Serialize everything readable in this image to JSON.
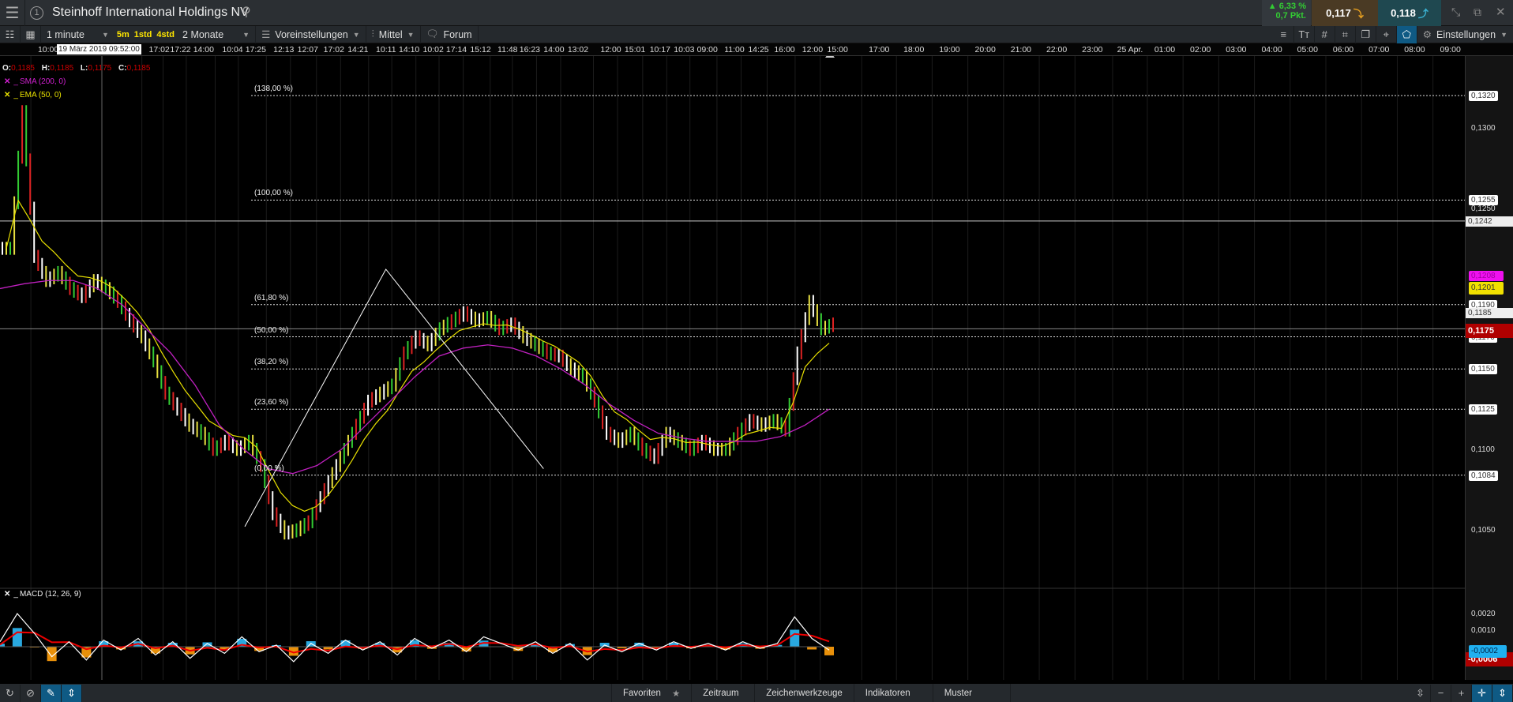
{
  "header": {
    "title": "Steinhoff International Holdings NV",
    "change_pct": "▲ 6,33 %",
    "change_pts": "0,7 Pkt.",
    "sell": "0,117",
    "buy": "0,118"
  },
  "toolbar": {
    "interval": "1 minute",
    "quick": [
      "5m",
      "1std",
      "4std"
    ],
    "range": "2 Monate",
    "presets": "Voreinstellungen",
    "type": "Mittel",
    "forum": "Forum",
    "settings": "Einstellungen"
  },
  "time_axis": {
    "tooltip": "19 März 2019 09:52:00",
    "labels": [
      "10:00",
      "17:02",
      "17:22",
      "14:00",
      "10:04",
      "17:25",
      "12:13",
      "12:07",
      "17:02",
      "14:21",
      "10:11",
      "14:10",
      "10:02",
      "17:14",
      "15:12",
      "11:48",
      "16:23",
      "14:00",
      "13:02",
      "12:00",
      "15:01",
      "10:17",
      "10:03",
      "09:00",
      "11:00",
      "14:25",
      "16:00",
      "12:00",
      "15:00",
      "17:00",
      "18:00",
      "19:00",
      "20:00",
      "21:00",
      "22:00",
      "23:00",
      "25 Apr.",
      "01:00",
      "02:00",
      "03:00",
      "04:00",
      "05:00",
      "06:00",
      "07:00",
      "08:00",
      "09:00"
    ]
  },
  "ohlc": {
    "o_label": "O:",
    "o": "0,1185",
    "h_label": "H:",
    "h": "0,1185",
    "l_label": "L:",
    "l": "0,1175",
    "c_label": "C:",
    "c": "0,1185"
  },
  "indicators": [
    {
      "name": "SMA (200, 0)",
      "color": "#d020d0"
    },
    {
      "name": "EMA (50, 0)",
      "color": "#e8e000"
    }
  ],
  "macd": {
    "name": "MACD (12, 26, 9)"
  },
  "price_axis": {
    "labels": [
      {
        "text": "0,1320",
        "v": 0.132,
        "box": true
      },
      {
        "text": "0,1300",
        "v": 0.13
      },
      {
        "text": "0,1255",
        "v": 0.1255,
        "box": true
      },
      {
        "text": "0,1250",
        "v": 0.125
      },
      {
        "text": "0,1242",
        "v": 0.1242,
        "kind": "grey"
      },
      {
        "text": "0,1208",
        "v": 0.1208,
        "kind": "magenta"
      },
      {
        "text": "0,1201",
        "v": 0.1201,
        "kind": "yellow"
      },
      {
        "text": "0,1190",
        "v": 0.119,
        "box": true
      },
      {
        "text": "0,1185",
        "v": 0.1185,
        "kind": "grey"
      },
      {
        "text": "0,1170",
        "v": 0.117,
        "box": true
      },
      {
        "text": "0,1175",
        "v": 0.1175,
        "kind": "red"
      },
      {
        "text": "0,1150",
        "v": 0.115,
        "box": true
      },
      {
        "text": "0,1125",
        "v": 0.1125,
        "box": true
      },
      {
        "text": "0,1100",
        "v": 0.11
      },
      {
        "text": "0,1084",
        "v": 0.1084,
        "box": true
      },
      {
        "text": "0,1050",
        "v": 0.105
      }
    ],
    "macd_labels": [
      {
        "text": "0,0020",
        "v": 0.002
      },
      {
        "text": "0,0010",
        "v": 0.001
      },
      {
        "text": "-0,0006",
        "v": -0.0006,
        "kind": "red"
      },
      {
        "text": "-0,0002",
        "v": -0.0002,
        "kind": "cyan"
      }
    ]
  },
  "fib": [
    {
      "label": "(138,00 %)",
      "v": 0.132
    },
    {
      "label": "(100,00 %)",
      "v": 0.1255
    },
    {
      "label": "(61,80 %)",
      "v": 0.119
    },
    {
      "label": "(50,00 %)",
      "v": 0.117
    },
    {
      "label": "(38,20 %)",
      "v": 0.115
    },
    {
      "label": "(23,60 %)",
      "v": 0.1125
    },
    {
      "label": "(0,00 %)",
      "v": 0.1084
    }
  ],
  "bottombar": {
    "favorites": "Favoriten",
    "period": "Zeitraum",
    "drawing": "Zeichenwerkzeuge",
    "indicators": "Indikatoren",
    "patterns": "Muster"
  },
  "chart_data": {
    "type": "line",
    "ylim": [
      0.103,
      0.1335
    ],
    "current": 0.1175,
    "hline": 0.1242,
    "close": [
      0.1225,
      0.131,
      0.122,
      0.1205,
      0.121,
      0.12,
      0.1195,
      0.1205,
      0.12,
      0.1192,
      0.118,
      0.117,
      0.1155,
      0.1135,
      0.1125,
      0.1115,
      0.111,
      0.11,
      0.1105,
      0.11,
      0.1105,
      0.109,
      0.106,
      0.1048,
      0.105,
      0.1055,
      0.107,
      0.1085,
      0.11,
      0.1115,
      0.113,
      0.1135,
      0.114,
      0.116,
      0.117,
      0.1165,
      0.1175,
      0.118,
      0.1185,
      0.118,
      0.1182,
      0.1175,
      0.1178,
      0.117,
      0.1165,
      0.116,
      0.1158,
      0.115,
      0.1145,
      0.113,
      0.111,
      0.1105,
      0.111,
      0.11,
      0.1095,
      0.111,
      0.1105,
      0.11,
      0.1105,
      0.11,
      0.11,
      0.111,
      0.1118,
      0.1115,
      0.1118,
      0.1112,
      0.116,
      0.1192,
      0.1175,
      0.1178
    ],
    "sma": [
      0.12,
      0.1203,
      0.1205,
      0.1205,
      0.12,
      0.119,
      0.1175,
      0.116,
      0.114,
      0.1115,
      0.11,
      0.1088,
      0.1085,
      0.109,
      0.11,
      0.1115,
      0.113,
      0.1145,
      0.1158,
      0.1163,
      0.1165,
      0.1163,
      0.1158,
      0.115,
      0.114,
      0.1128,
      0.1118,
      0.111,
      0.1107,
      0.1105,
      0.1105,
      0.1105,
      0.1108,
      0.1115,
      0.1125
    ],
    "zigzag": [
      [
        0.295,
        0.1052
      ],
      [
        0.465,
        0.1212
      ],
      [
        0.655,
        0.1088
      ]
    ],
    "macd": [
      0.0003,
      0.002,
      0.0008,
      -0.0006,
      0.0003,
      -0.0008,
      0.0004,
      -0.0002,
      0.0005,
      -0.0005,
      0.0003,
      -0.0007,
      0.0002,
      -0.0004,
      0.0006,
      -0.0003,
      0.0001,
      -0.0009,
      0.0002,
      -0.0004,
      0.0004,
      -0.0002,
      0.0003,
      -0.0005,
      0.0005,
      -0.0001,
      0.0004,
      -0.0003,
      0.0006,
      0.0002,
      -0.0002,
      0.0003,
      -0.0004,
      0.0002,
      -0.0008,
      0.0001,
      -0.0003,
      0.0002,
      -0.0002,
      0.0003,
      -0.0001,
      0.0002,
      -0.0002,
      0.0003,
      -0.0001,
      0.0002,
      0.0018,
      0.0005,
      -0.0002
    ]
  }
}
